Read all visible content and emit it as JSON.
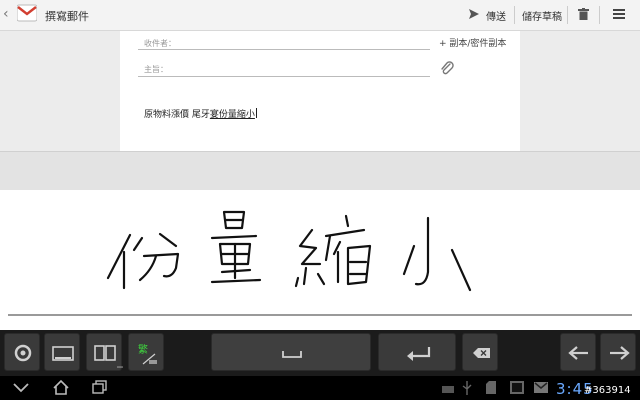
{
  "header": {
    "title": "撰寫郵件",
    "send_label": "傳送",
    "save_draft_label": "儲存草稿"
  },
  "compose": {
    "to_label": "收件者：",
    "subject_label": "主旨：",
    "cc_bcc_label": "+ 副本/密件副本",
    "body_prefix": "原物料漲價 尾牙",
    "body_composing": "宴份量縮小"
  },
  "handwriting": {
    "recognized_text": "份量縮小"
  },
  "keyboard": {
    "layout_key_text": "繁"
  },
  "status": {
    "clock": "3:45",
    "watermark": "#363914"
  },
  "colors": {
    "accent_blue": "#6aa9ff",
    "key_green": "#3ed23e"
  }
}
